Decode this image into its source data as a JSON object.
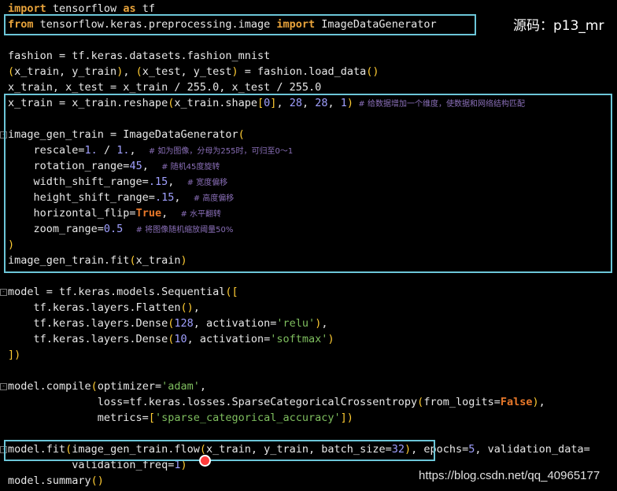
{
  "watermark_top": "源码：p13_mr",
  "watermark_bottom": "https://blog.csdn.net/qq_40965177",
  "code": {
    "l1": [
      "import",
      " tensorflow ",
      "as",
      " tf"
    ],
    "l2": [
      "from",
      " tensorflow.keras.preprocessing.image ",
      "import",
      " ImageDataGenerator"
    ],
    "l3": "fashion = tf.keras.datasets.fashion_mnist",
    "l4": [
      "(",
      "x_train, y_train",
      ")",
      ", ",
      "(",
      "x_test, y_test",
      ")",
      " = fashion.load_data",
      "()"
    ],
    "l5": "x_train, x_test = x_train / 255.0, x_test / 255.0",
    "l6": [
      "x_train = x_train.reshape",
      "(",
      "x_train.shape",
      "[",
      "0",
      "]",
      ", ",
      "28",
      ", ",
      "28",
      ", ",
      "1",
      ")",
      "  # 给数据增加一个维度，使数据和网络结构匹配"
    ],
    "l7": [
      "image_gen_train = ImageDataGenerator",
      "("
    ],
    "l8": [
      "    rescale=",
      "1.",
      " / ",
      "1.",
      ",  ",
      "# 如为图像，分母为255时，可归至0～1"
    ],
    "l9": [
      "    rotation_range=",
      "45",
      ",  ",
      "# 随机45度旋转"
    ],
    "l10": [
      "    width_shift_range=",
      ".15",
      ",  ",
      "# 宽度偏移"
    ],
    "l11": [
      "    height_shift_range=",
      ".15",
      ",  ",
      "# 高度偏移"
    ],
    "l12": [
      "    horizontal_flip=",
      "True",
      ",  ",
      "# 水平翻转"
    ],
    "l13": [
      "    zoom_range=",
      "0.5",
      "  ",
      "# 将图像随机缩放阈量50%"
    ],
    "l14": ")",
    "l15": [
      "image_gen_train.fit",
      "(",
      "x_train",
      ")"
    ],
    "l16": [
      "model = tf.keras.models.Sequential",
      "(["
    ],
    "l17": [
      "    tf.keras.layers.Flatten",
      "()",
      ","
    ],
    "l18": [
      "    tf.keras.layers.Dense",
      "(",
      "128",
      ", activation=",
      "'relu'",
      ")",
      ","
    ],
    "l19": [
      "    tf.keras.layers.Dense",
      "(",
      "10",
      ", activation=",
      "'softmax'",
      ")"
    ],
    "l20": "])",
    "l21": [
      "model.compile",
      "(",
      "optimizer=",
      "'adam'",
      ","
    ],
    "l22": [
      "              loss=tf.keras.losses.SparseCategoricalCrossentropy",
      "(",
      "from_logits=",
      "False",
      ")",
      ","
    ],
    "l23": [
      "              metrics=",
      "[",
      "'sparse_categorical_accuracy'",
      "])"
    ],
    "l24": [
      "model.fit",
      "(",
      "image_gen_train.flow",
      "(",
      "x_train, y_train, batch_size=",
      "32",
      ")",
      ", epochs=",
      "5",
      ", validation_data="
    ],
    "l25": [
      "          validation_freq=",
      "1",
      ")"
    ],
    "l26": [
      "model.summary",
      "()"
    ]
  }
}
